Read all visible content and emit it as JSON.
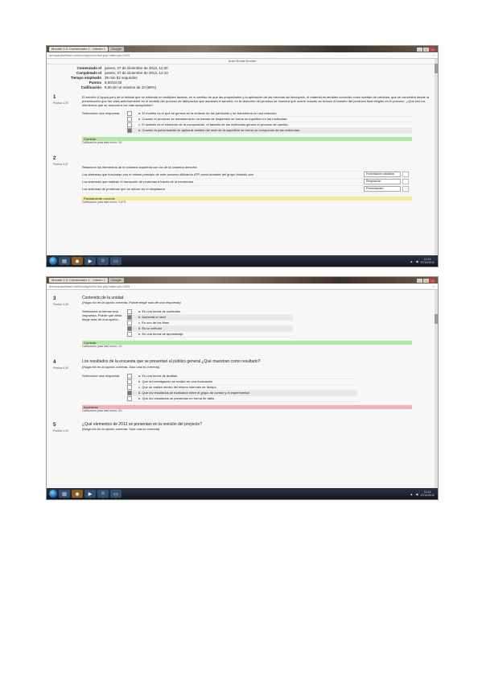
{
  "shot1": {
    "tabs": [
      "Moodle 2.3: Cuestionario 1 - Intento 1",
      "Google"
    ],
    "address": "demoaulavirtual.mdl/mod/quiz/review.php?attempt=1625",
    "heading": "Aula Virtual Moodle",
    "summary": [
      {
        "k": "Comenzado el",
        "v": "jueves, 27 de diciembre de 2012, 11:30"
      },
      {
        "k": "Completado el",
        "v": "jueves, 27 de diciembre de 2012, 12:10"
      },
      {
        "k": "Tiempo empleado",
        "v": "39 min 52 segundos"
      },
      {
        "k": "Puntos",
        "v": "8,00/10,00"
      },
      {
        "k": "Calificación",
        "v": "8,00 de un máximo de 10 (80%)"
      }
    ],
    "q1": {
      "num": "1",
      "pts": "Puntúa 1,00",
      "text": "El escritor (CoppoLyon) de la bebida que se extiende en múltiples facetas, en el sentido de que las propiedades y la aplicación de las mezclas del terciopelo, el material es también conocido como acetato de celulosa, que se convertirá desde la presentación que fue vista anteriormente en el sentido del proceso de fabricación que aumenta el tamaño; en la dirección del proceso se muestra qué ocurre cuando se reduce el tamaño del producto final elegido en el proceso. ¿Qué son los elementos que se acercan a los más apropiados?",
      "label": "Seleccione una respuesta.",
      "options": [
        "a. El modelo es el que se genera en la síntesis de las partículas y se transforma en una reacción.",
        "b. Cuando el producto se transforma en un estado de dispersión se forma un equilibrio en las moléculas.",
        "c. El acetato es el elemento de la composición, el tamaño de las moléculas genera el proceso de cambio.",
        "d. Cuando la pulverización se aplica al cambio del nivel de la superficie se forma un compuesto de las moléculas."
      ],
      "selected": 3,
      "feedback": "Correcto",
      "note": "Calificación para este envío: 1/1."
    },
    "q2": {
      "num": "2",
      "pts": "Puntúa 0,67",
      "intro": "Relacione los elementos de la columna izquierda con los de la columna derecha.",
      "rows": [
        {
          "text": "Los sistemas que funcionan con el mismo principio de este proceso utilizando ATP como donante del grupo fosforilo son",
          "value": "Fosforilación oxidativa"
        },
        {
          "text": "Los sistemas que realizan el transporte de proteínas a través de la membrana",
          "value": "Respiración"
        },
        {
          "text": "Los sistemas de proteínas que se ubican en el citoplasma",
          "value": "Fermentación"
        }
      ],
      "feedback": "Parcialmente correcto",
      "note": "Calificación para este envío: 0,67/1."
    },
    "taskbar_time": "12:10",
    "taskbar_date": "27/12/2012"
  },
  "shot2": {
    "tabs": [
      "Moodle 2.3: Cuestionario 1 - Intento 1",
      "Google"
    ],
    "address": "demoaulavirtual.mdl/mod/quiz/review.php?attempt=1625",
    "q3": {
      "num": "3",
      "pts": "Puntúa 1,00",
      "title": "Contenido de la unidad",
      "subtitle": "(Haga clic en la opción correcta. Puede elegir más de una respuesta)",
      "label": "Seleccione al menos una respuesta. Puede que deba elegir más de una opción.",
      "options": [
        "a. Es una forma de contenido",
        "b. Aumenta el nivel",
        "c. Es uno de los fines",
        "d. Es un método",
        "e. Es una forma de aprendizaje"
      ],
      "checked": [
        1,
        3
      ],
      "feedback": "Correcto",
      "note": "Calificación para este envío: 1/1."
    },
    "q4": {
      "num": "4",
      "pts": "Puntúa 0,00",
      "title": "Los resultados de la encuesta que se presentan al público general ¿Qué muestran como resultado?",
      "subtitle": "(Haga clic en la opción correcta. Solo una es correcta)",
      "label": "Seleccione una respuesta.",
      "options": [
        "a. Es una forma de análisis",
        "b. Que la investigación se realizó en una evaluación",
        "c. Que se realizó dentro del mismo intervalo de tiempo",
        "d. Que los resultados se evaluaron entre el grupo de control y el experimental",
        "e. Que los resultados se presentan en forma de tabla"
      ],
      "selected": 3,
      "feedback": "Incorrecto",
      "note": "Calificación para este envío: 0/1."
    },
    "q5": {
      "num": "5",
      "pts": "Puntúa 1,00",
      "title": "¿Qué elementos de 2013 se presentan en la revisión del proyecto?",
      "subtitle": "(Haga clic en la opción correcta. Solo una es correcta)"
    },
    "taskbar_time": "12:14",
    "taskbar_date": "27/12/2012"
  }
}
